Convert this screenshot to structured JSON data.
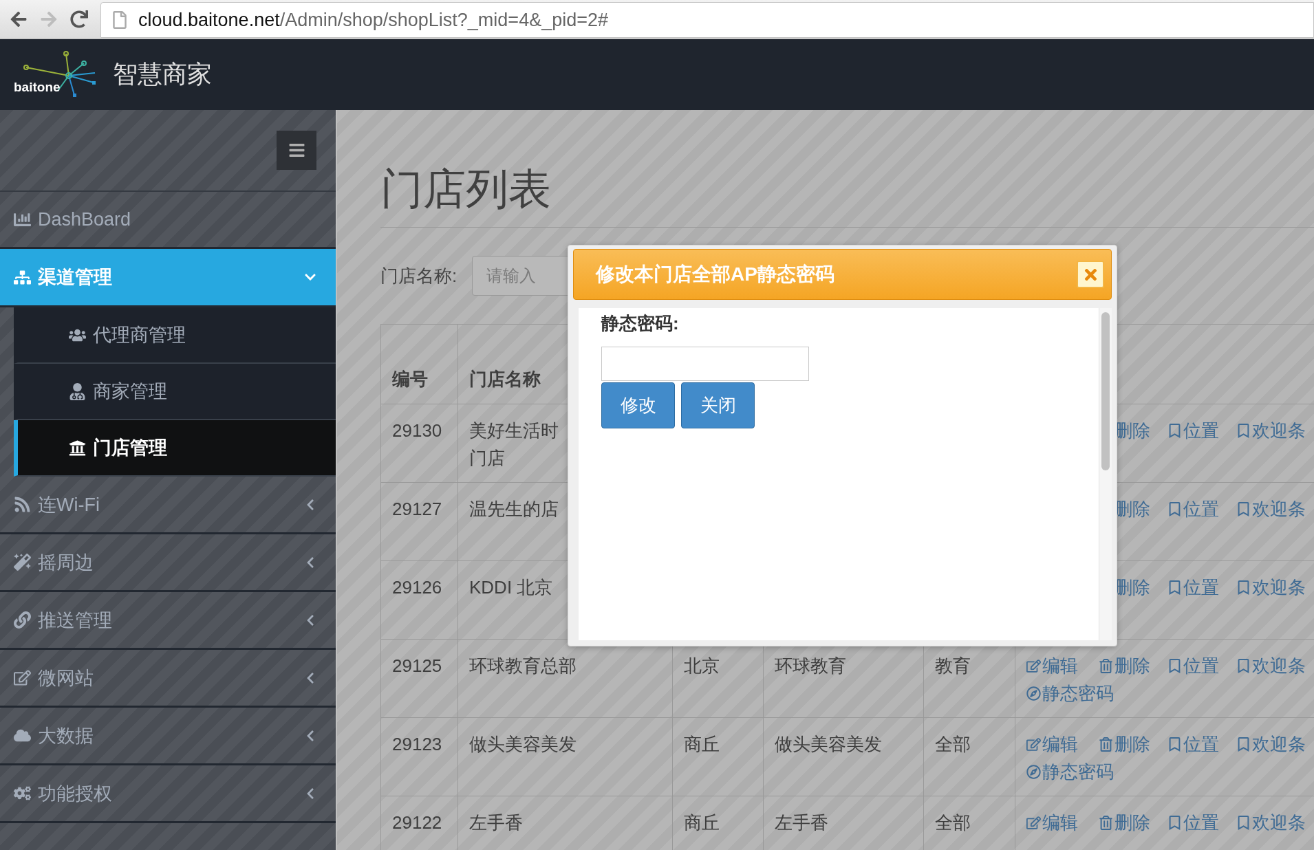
{
  "browser": {
    "url_host": "cloud.baitone.net",
    "url_path": "/Admin/shop/shopList?_mid=4&_pid=2#"
  },
  "header": {
    "logo_text": "baitone",
    "title": "智慧商家"
  },
  "sidebar": {
    "items": [
      {
        "label": "DashBoard",
        "kind": "link"
      },
      {
        "label": "渠道管理",
        "kind": "group",
        "expanded": true,
        "children": [
          {
            "label": "代理商管理",
            "selected": false
          },
          {
            "label": "商家管理",
            "selected": false
          },
          {
            "label": "门店管理",
            "selected": true
          }
        ]
      },
      {
        "label": "连Wi-Fi",
        "kind": "group",
        "expanded": false
      },
      {
        "label": "摇周边",
        "kind": "group",
        "expanded": false
      },
      {
        "label": "推送管理",
        "kind": "group",
        "expanded": false
      },
      {
        "label": "微网站",
        "kind": "group",
        "expanded": false
      },
      {
        "label": "大数据",
        "kind": "group",
        "expanded": false
      },
      {
        "label": "功能授权",
        "kind": "group",
        "expanded": false
      }
    ]
  },
  "page": {
    "title": "门店列表",
    "search_label": "门店名称:",
    "search_placeholder": "请输入"
  },
  "table": {
    "columns": [
      "编号",
      "门店名称"
    ],
    "rows": [
      {
        "id": "29130",
        "name": [
          "美好生活时",
          "门店"
        ],
        "actions": [
          {
            "kind": "delete",
            "label": "删除"
          },
          {
            "kind": "location",
            "label": "位置"
          },
          {
            "kind": "welcome",
            "label": "欢迎条"
          }
        ]
      },
      {
        "id": "29127",
        "name": [
          "温先生的店"
        ],
        "actions": [
          {
            "kind": "delete",
            "label": "删除"
          },
          {
            "kind": "location",
            "label": "位置"
          },
          {
            "kind": "welcome",
            "label": "欢迎条"
          }
        ]
      },
      {
        "id": "29126",
        "name": [
          "KDDI 北京"
        ],
        "actions": [
          {
            "kind": "delete",
            "label": "删除"
          },
          {
            "kind": "location",
            "label": "位置"
          },
          {
            "kind": "welcome",
            "label": "欢迎条"
          }
        ]
      },
      {
        "id": "29125",
        "name": [
          "环球教育总部"
        ],
        "column_3": "北京",
        "column_4": "环球教育",
        "column_5": "教育",
        "actions": [
          {
            "kind": "edit",
            "label": "编辑"
          },
          {
            "kind": "delete",
            "label": "删除"
          },
          {
            "kind": "location",
            "label": "位置"
          },
          {
            "kind": "welcome",
            "label": "欢迎条"
          },
          {
            "kind": "password",
            "label": "静态密码"
          }
        ]
      },
      {
        "id": "29123",
        "name": [
          "做头美容美发"
        ],
        "column_3": "商丘",
        "column_4": "做头美容美发",
        "column_5": "全部",
        "actions": [
          {
            "kind": "edit",
            "label": "编辑"
          },
          {
            "kind": "delete",
            "label": "删除"
          },
          {
            "kind": "location",
            "label": "位置"
          },
          {
            "kind": "welcome",
            "label": "欢迎条"
          },
          {
            "kind": "password",
            "label": "静态密码"
          }
        ]
      },
      {
        "id": "29122",
        "name": [
          "左手香"
        ],
        "column_3": "商丘",
        "column_4": "左手香",
        "column_5": "全部",
        "actions": [
          {
            "kind": "edit",
            "label": "编辑"
          },
          {
            "kind": "delete",
            "label": "删除"
          },
          {
            "kind": "location",
            "label": "位置"
          },
          {
            "kind": "welcome",
            "label": "欢迎条"
          }
        ]
      }
    ]
  },
  "dialog": {
    "title": "修改本门店全部AP静态密码",
    "field_label": "静态密码:",
    "buttons": [
      "修改",
      "关闭"
    ]
  }
}
